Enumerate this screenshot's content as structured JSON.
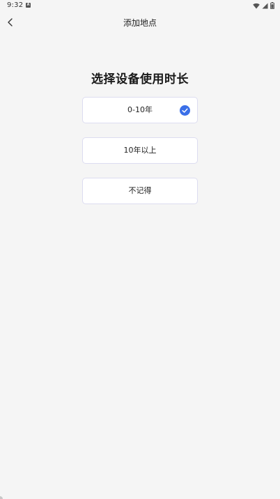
{
  "status_bar": {
    "time": "9:32",
    "notification_glyph": "A",
    "icons": [
      "wifi-icon",
      "cell-signal-icon",
      "battery-icon"
    ]
  },
  "header": {
    "back_icon": "chevron-left-icon",
    "title": "添加地点"
  },
  "question": "选择设备使用时长",
  "options": [
    {
      "label": "0-10年",
      "selected": true
    },
    {
      "label": "10年以上",
      "selected": false
    },
    {
      "label": "不记得",
      "selected": false
    }
  ],
  "colors": {
    "background": "#f5f5f5",
    "card": "#ffffff",
    "card_border": "#dcdcf0",
    "accent": "#3a6fe8"
  }
}
